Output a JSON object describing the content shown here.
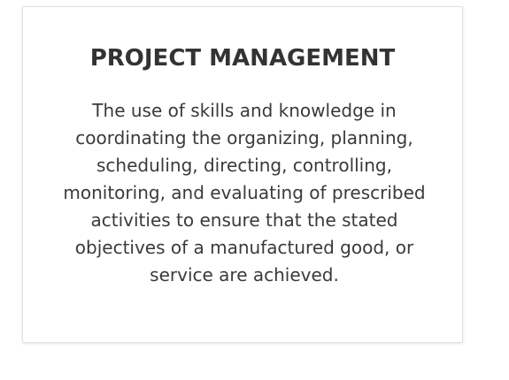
{
  "card": {
    "title": "PROJECT MANAGEMENT",
    "description": "The use of skills and knowledge in coordinating the organizing, planning, scheduling, directing, controlling, monitoring, and evaluating of prescribed activities to ensure that the stated objectives of a manufactured good, or service are achieved."
  },
  "colors": {
    "text": "#333333",
    "border": "#e2e2e2",
    "background": "#ffffff"
  }
}
